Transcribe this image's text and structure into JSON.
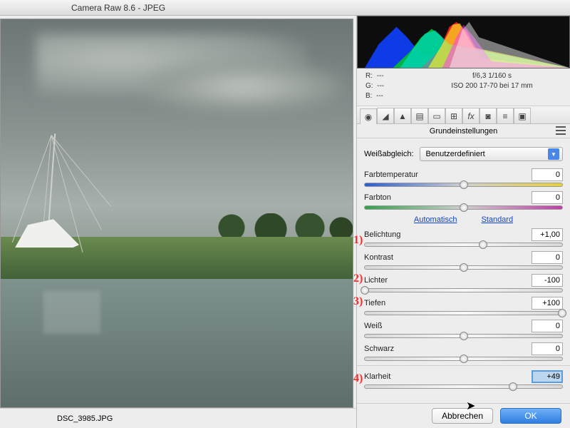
{
  "window": {
    "title": "Camera Raw 8.6 - JPEG"
  },
  "preview": {
    "filename": "DSC_3985.JPG"
  },
  "meta": {
    "r": "R:",
    "r_val": "---",
    "g": "G:",
    "g_val": "---",
    "b": "B:",
    "b_val": "---",
    "line1": "f/6,3   1/160 s",
    "line2": "ISO 200   17-70 bei 17 mm"
  },
  "panel": {
    "title": "Grundeinstellungen",
    "wb_label": "Weißabgleich:",
    "wb_value": "Benutzerdefiniert",
    "auto": "Automatisch",
    "standard": "Standard"
  },
  "sliders": {
    "temperature": {
      "label": "Farbtemperatur",
      "value": "0",
      "pos": 50
    },
    "tint": {
      "label": "Farbton",
      "value": "0",
      "pos": 50
    },
    "exposure": {
      "label": "Belichtung",
      "value": "+1,00",
      "pos": 60
    },
    "contrast": {
      "label": "Kontrast",
      "value": "0",
      "pos": 50
    },
    "highlights": {
      "label": "Lichter",
      "value": "-100",
      "pos": 0
    },
    "shadows": {
      "label": "Tiefen",
      "value": "+100",
      "pos": 100
    },
    "whites": {
      "label": "Weiß",
      "value": "0",
      "pos": 50
    },
    "blacks": {
      "label": "Schwarz",
      "value": "0",
      "pos": 50
    },
    "clarity": {
      "label": "Klarheit",
      "value": "+49",
      "pos": 75
    }
  },
  "annotations": {
    "a1": "1)",
    "a2": "2)",
    "a3": "3)",
    "a4": "4)"
  },
  "footer": {
    "cancel": "Abbrechen",
    "ok": "OK"
  }
}
